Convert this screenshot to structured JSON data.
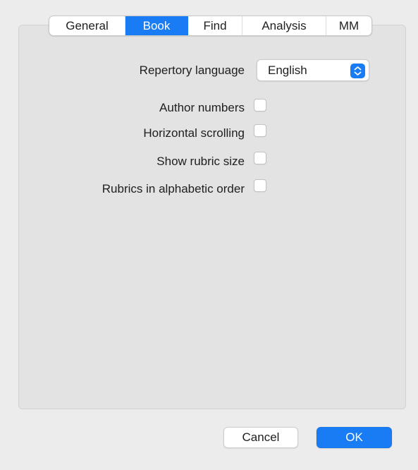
{
  "tabs": [
    {
      "label": "General",
      "selected": false
    },
    {
      "label": "Book",
      "selected": true
    },
    {
      "label": "Find",
      "selected": false
    },
    {
      "label": "Analysis",
      "selected": false
    },
    {
      "label": "MM",
      "selected": false
    }
  ],
  "book_settings": {
    "repertory_language": {
      "label": "Repertory language",
      "value": "English"
    },
    "options": [
      {
        "label": "Author numbers",
        "checked": false
      },
      {
        "label": "Horizontal scrolling",
        "checked": false
      },
      {
        "label": "Show rubric size",
        "checked": false
      },
      {
        "label": "Rubrics in alphabetic order",
        "checked": false
      }
    ]
  },
  "buttons": {
    "cancel_label": "Cancel",
    "ok_label": "OK"
  },
  "colors": {
    "accent": "#1a7cf5",
    "panel_background": "#e3e3e3",
    "window_background": "#ececec"
  },
  "icons": {
    "popup_indicator": "up-down-chevron-icon",
    "checkbox": "checkbox-unchecked"
  }
}
